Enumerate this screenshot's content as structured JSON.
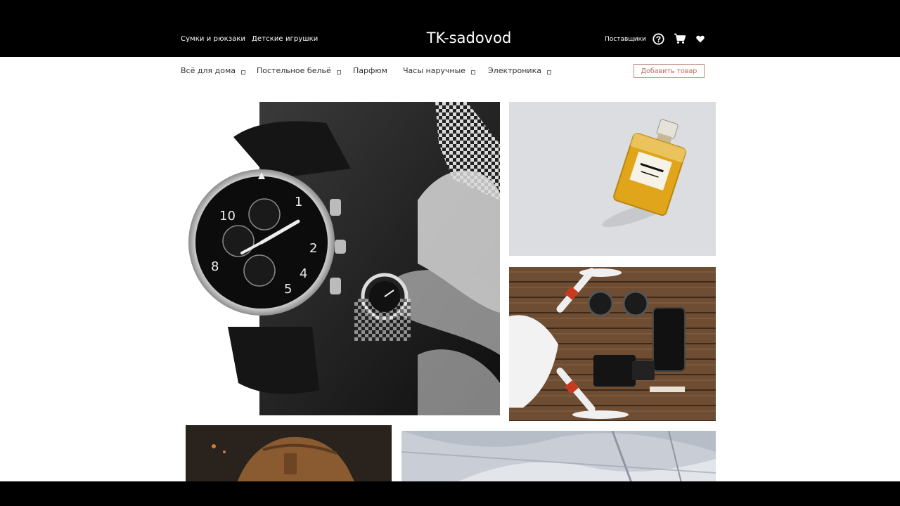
{
  "header": {
    "left_links": [
      "Сумки и рюкзаки",
      "Детские игрушки"
    ],
    "brand": "TK-sadovod",
    "suppliers_link": "Поставщики",
    "icons": [
      "help-icon",
      "cart-icon",
      "heart-icon"
    ]
  },
  "categories": {
    "items": [
      {
        "label": "Всё для дома",
        "has_dropdown": true
      },
      {
        "label": "Постельное бельё",
        "has_dropdown": true
      },
      {
        "label": "Парфюм",
        "has_dropdown": false
      },
      {
        "label": "Часы наручные",
        "has_dropdown": true
      },
      {
        "label": "Электроника",
        "has_dropdown": true
      }
    ],
    "add_button": "Добавить товар"
  },
  "tiles": [
    {
      "subject": "wristwatch"
    },
    {
      "subject": "perfume bottle"
    },
    {
      "subject": "drone and camera gear"
    },
    {
      "subject": "leather backpack"
    },
    {
      "subject": "plaid fabric"
    }
  ],
  "colors": {
    "header_bg": "#000000",
    "content_bg": "#ffffff",
    "accent": "#b06b5e"
  }
}
